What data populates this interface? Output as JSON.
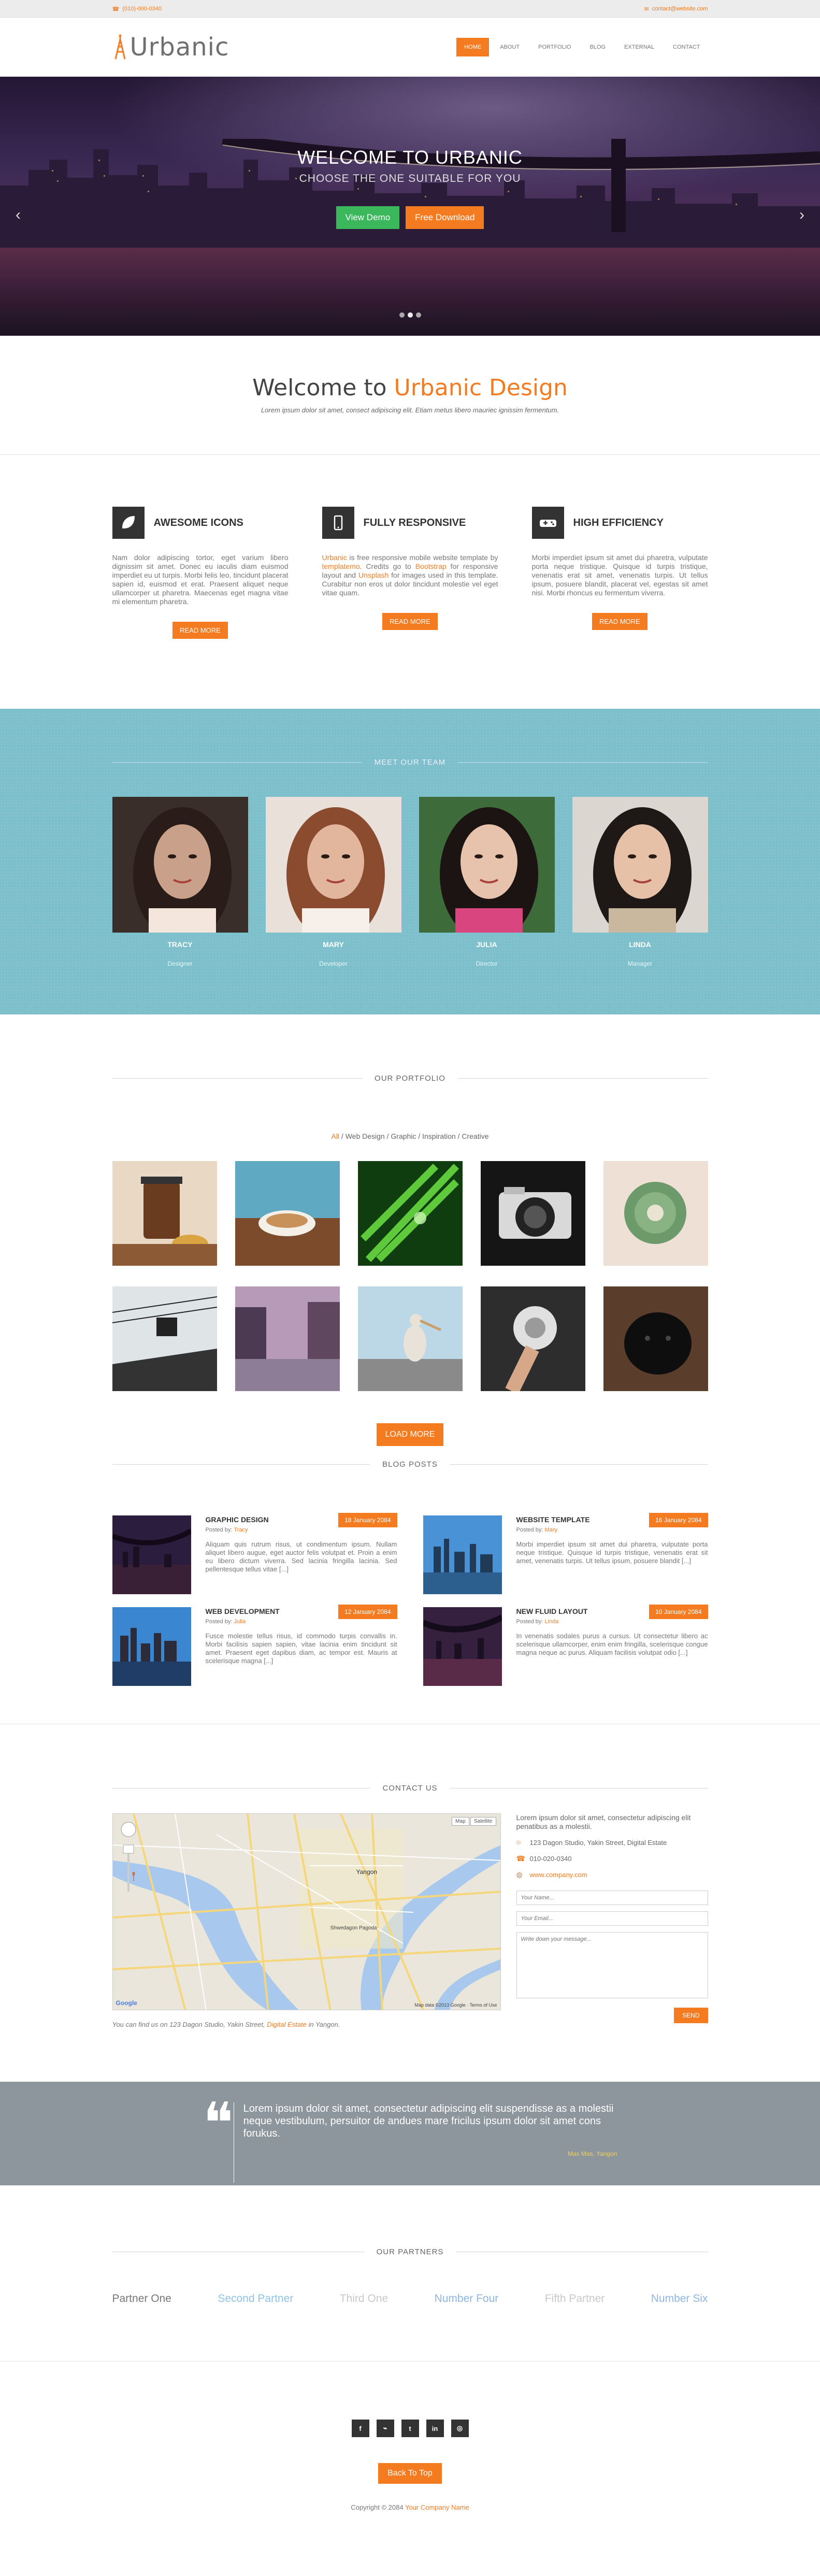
{
  "topbar": {
    "phone": "(010)-000-0340",
    "email": "contact@website.com"
  },
  "header": {
    "brand": "Urbanic",
    "nav": [
      {
        "label": "HOME",
        "active": true
      },
      {
        "label": "ABOUT"
      },
      {
        "label": "PORTFOLIO"
      },
      {
        "label": "BLOG"
      },
      {
        "label": "EXTERNAL"
      },
      {
        "label": "CONTACT"
      }
    ]
  },
  "hero": {
    "title": "WELCOME TO URBANIC",
    "subtitle": "CHOOSE THE ONE SUITABLE FOR YOU",
    "view_demo": "View Demo",
    "free_download": "Free Download",
    "slides_total": 3,
    "slide_active": 1
  },
  "welcome": {
    "title_pre": "Welcome to",
    "title_accent": "Urbanic Design",
    "tagline": "Lorem ipsum dolor sit amet, consect adipiscing elit. Etiam metus libero mauriec ignissim fermentum."
  },
  "features": [
    {
      "icon": "leaf-icon",
      "title": "AWESOME ICONS",
      "text": "Nam dolor adipiscing tortor, eget varium libero dignissim sit amet. Donec eu iaculis diam euismod imperdiet eu ut turpis. Morbi felis leo, tincidunt placerat sapien id, euismod et erat. Praesent aliquet neque ullamcorper ut pharetra. Maecenas eget magna vitae mi elementum pharetra.",
      "btn": "READ MORE"
    },
    {
      "icon": "mobile-icon",
      "title": "FULLY RESPONSIVE",
      "text_parts": [
        "Urbanic",
        " is free responsive mobile website template by ",
        "templatemo",
        ". Credits go to ",
        "Bootstrap",
        " for responsive layout and ",
        "Unsplash",
        " for images used in this template. Curabitur non eros ut dolor tincidunt molestie vel eget vitae quam."
      ],
      "btn": "READ MORE"
    },
    {
      "icon": "game-controller-icon",
      "title": "HIGH EFFICIENCY",
      "text": "Morbi imperdiet ipsum sit amet dui pharetra, vulputate porta neque tristique. Quisque id turpis tristique, venenatis erat sit amet, venenatis turpis. Ut tellus ipsum, posuere blandit, placerat vel, egestas sit amet nisi. Morbi rhoncus eu fermentum viverra.",
      "btn": "READ MORE"
    }
  ],
  "team": {
    "heading": "MEET OUR TEAM",
    "members": [
      {
        "name": "TRACY",
        "role": "Designer"
      },
      {
        "name": "MARY",
        "role": "Developer"
      },
      {
        "name": "JULIA",
        "role": "Director"
      },
      {
        "name": "LINDA",
        "role": "Manager"
      }
    ]
  },
  "portfolio": {
    "heading": "OUR PORTFOLIO",
    "filters": [
      "All",
      "Web Design",
      "Graphic",
      "Inspiration",
      "Creative"
    ],
    "load_more": "LOAD MORE",
    "tiles": [
      "tea-press",
      "coffee-cup",
      "green-leaf",
      "camera",
      "cactus",
      "cable-car",
      "canal-buildings",
      "pelican-pier",
      "dandelion",
      "black-dog"
    ]
  },
  "blog": {
    "heading": "BLOG POSTS",
    "posted_by": "Posted by:",
    "posts": [
      {
        "title": "GRAPHIC DESIGN",
        "author": "Tracy",
        "date": "18 January 2084",
        "excerpt": "Aliquam quis rutrum risus, ut condimentum ipsum. Nullam aliquet libero augue, eget auctor felis volutpat et. Proin a enim eu libero dictum viverra. Sed lacinia fringilla lacinia. Sed pellentesque tellus vitae [...]",
        "thumb": "bridge-night"
      },
      {
        "title": "WEBSITE TEMPLATE",
        "author": "Mary",
        "date": "16 January 2084",
        "excerpt": "Morbi imperdiet ipsum sit amet dui pharetra, vulputate porta neque tristique. Quisque id turpis tristique, venenatis erat sit amet, venenatis turpis. Ut tellus ipsum, posuere blandit [...]",
        "thumb": "skyline-blue"
      },
      {
        "title": "WEB DEVELOPMENT",
        "author": "Julia",
        "date": "12 January 2084",
        "excerpt": "Fusce molestie tellus risus, id commodo turpis convallis in. Morbi facilisis sapien sapien, vitae lacinia enim tincidunt sit amet. Praesent eget dapibus diam, ac tempor est. Mauris at scelerisque magna [...]",
        "thumb": "skyline-dusk"
      },
      {
        "title": "NEW FLUID LAYOUT",
        "author": "Linda",
        "date": "10 January 2084",
        "excerpt": "In venenatis sodales purus a cursus. Ut consectetur libero ac scelerisque ullamcorper, enim enim fringilla, scelerisque congue magna neque ac purus. Aliquam facilisis volutpat odio [...]",
        "thumb": "bridge-lights"
      }
    ]
  },
  "contact": {
    "heading": "CONTACT US",
    "intro": "Lorem ipsum dolor sit amet, consectetur adipiscing elit penatibus as a molestii.",
    "address": "123 Dagon Studio, Yakin Street, Digital Estate",
    "phone": "010-020-0340",
    "website": "www.company.com",
    "name_placeholder": "Your Name...",
    "email_placeholder": "Your Email...",
    "message_placeholder": "Write down your message...",
    "send": "SEND",
    "findus_pre": "You can find us on 123 Dagon Studio, Yakin Street,",
    "findus_link": "Digital Estate",
    "findus_post": "in Yangon.",
    "map": {
      "map_btn": "Map",
      "satellite_btn": "Satellite",
      "city_label": "Yangon",
      "place_label": "Shwedagon Pagoda",
      "google": "Google",
      "credits": "Map data ©2013 Google · Terms of Use"
    }
  },
  "quote": {
    "text": "Lorem ipsum dolor sit amet, consectetur adipiscing elit suspendisse as a molestii neque vestibulum, persuitor de andues mare fricilus ipsum dolor sit amet cons forukus.",
    "author": "Max Mas, Yangon"
  },
  "partners": {
    "heading": "OUR PARTNERS",
    "items": [
      {
        "name": "Partner One",
        "color": "#777777"
      },
      {
        "name": "Second Partner",
        "color": "#8fc3e6"
      },
      {
        "name": "Third One",
        "color": "#c9c9c9"
      },
      {
        "name": "Number Four",
        "color": "#8fb6e0"
      },
      {
        "name": "Fifth Partner",
        "color": "#c9c9c9"
      },
      {
        "name": "Number Six",
        "color": "#8fb6e0"
      }
    ]
  },
  "footer": {
    "social": [
      {
        "icon": "facebook-icon",
        "glyph": "f"
      },
      {
        "icon": "rss-icon",
        "glyph": "⌁"
      },
      {
        "icon": "twitter-icon",
        "glyph": "t"
      },
      {
        "icon": "linkedin-icon",
        "glyph": "in"
      },
      {
        "icon": "dribbble-icon",
        "glyph": "◎"
      }
    ],
    "back_to_top": "Back To Top",
    "copyright": "Copyright © 2084",
    "company": "Your Company Name"
  },
  "colors": {
    "accent": "#f47b20",
    "team_bg": "#7dc0cc",
    "quote_bg": "#8c969c"
  }
}
